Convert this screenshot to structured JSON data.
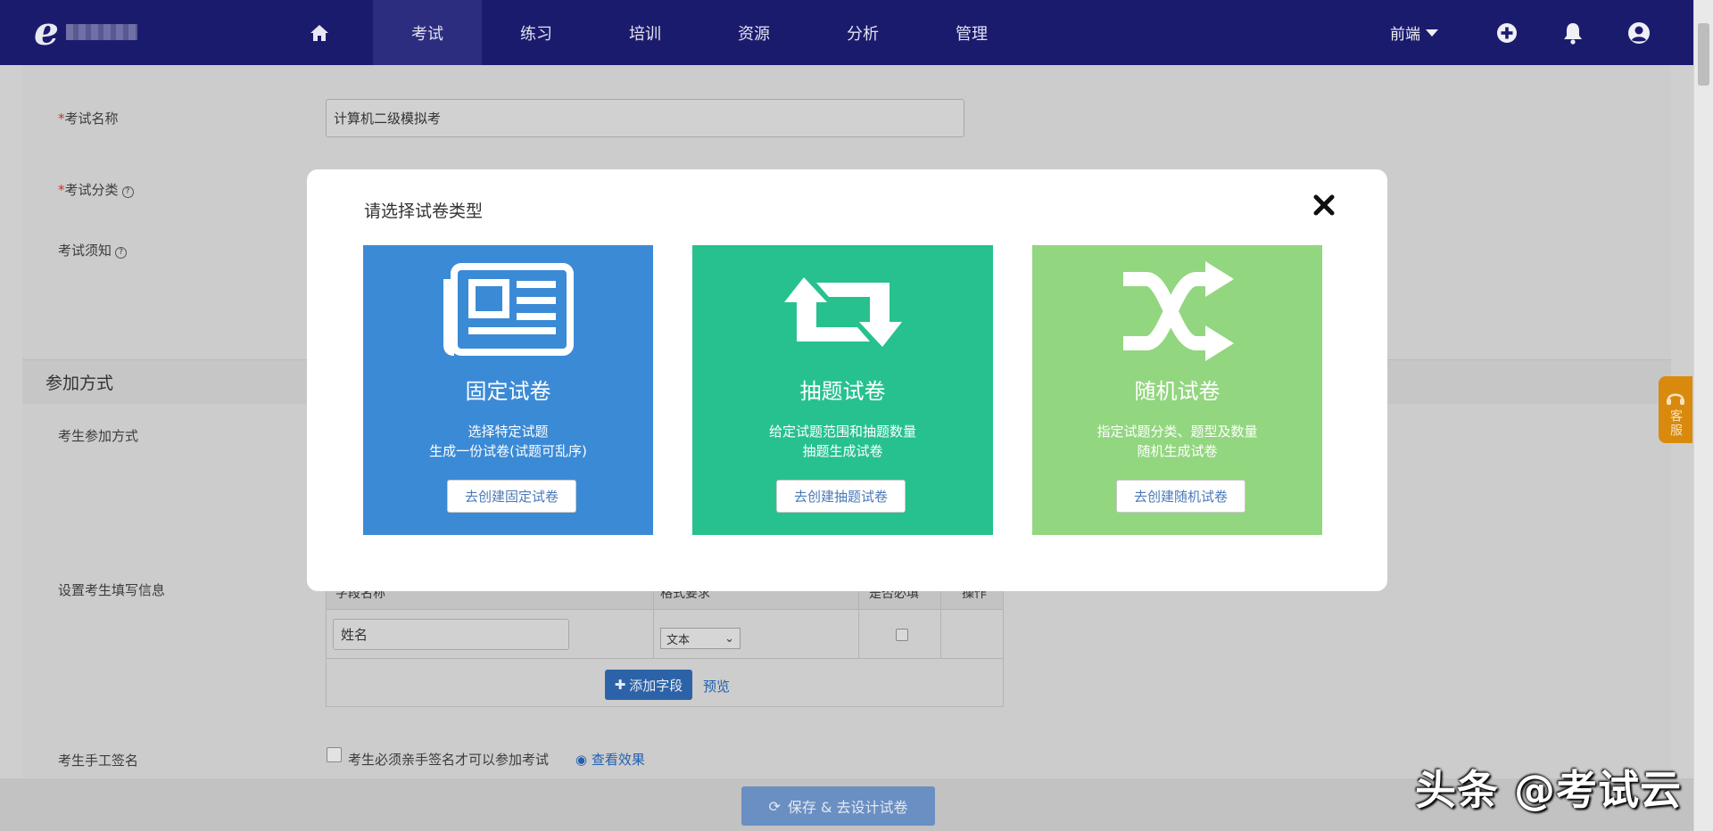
{
  "nav": {
    "items": [
      {
        "label": "考试",
        "active": true
      },
      {
        "label": "练习"
      },
      {
        "label": "培训"
      },
      {
        "label": "资源"
      },
      {
        "label": "分析"
      },
      {
        "label": "管理"
      }
    ],
    "terminal_dropdown": "前端"
  },
  "form": {
    "exam_name_label": "考试名称",
    "exam_name_value": "计算机二级模拟考",
    "exam_category_label": "考试分类",
    "exam_notice_label": "考试须知",
    "section_join": "参加方式",
    "join_method_label": "考生参加方式",
    "fill_info_label": "设置考生填写信息",
    "table_headers": [
      "字段名称",
      "格式要求",
      "是否必填",
      "操作"
    ],
    "field_name_value": "姓名",
    "format_value": "文本",
    "add_field_label": "添加字段",
    "preview_label": "预览",
    "signature_label": "考生手工签名",
    "signature_checkbox_text": "考生必须亲手签名才可以参加考试",
    "view_effect_label": "查看效果",
    "save_button": "保存 & 去设计试卷"
  },
  "side_service": "客服",
  "watermark": "头条 @考试云",
  "modal": {
    "title": "请选择试卷类型",
    "cards": [
      {
        "title": "固定试卷",
        "desc1": "选择特定试题",
        "desc2": "生成一份试卷(试题可乱序)",
        "button": "去创建固定试卷",
        "color": "#3b8ad6",
        "icon": "newspaper-icon"
      },
      {
        "title": "抽题试卷",
        "desc1": "给定试题范围和抽题数量",
        "desc2": "抽题生成试卷",
        "button": "去创建抽题试卷",
        "color": "#27c18f",
        "icon": "retweet-icon"
      },
      {
        "title": "随机试卷",
        "desc1": "指定试题分类、题型及数量",
        "desc2": "随机生成试卷",
        "button": "去创建随机试卷",
        "color": "#92d67f",
        "icon": "shuffle-icon"
      }
    ]
  }
}
